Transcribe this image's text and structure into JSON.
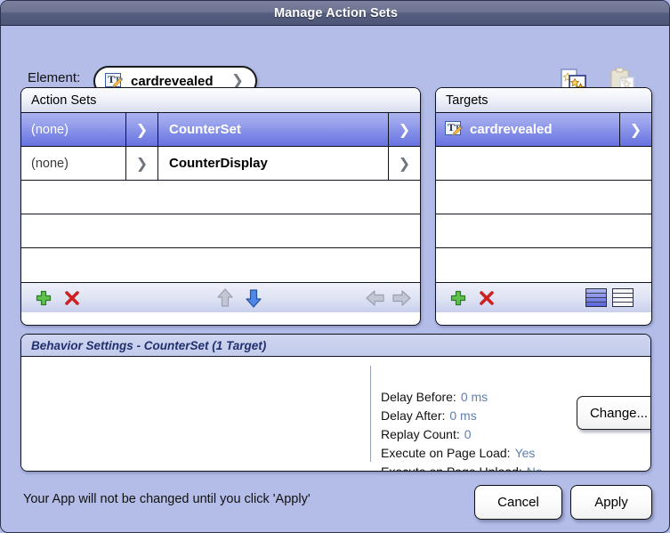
{
  "window": {
    "title": "Manage Action Sets"
  },
  "element_bar": {
    "label": "Element:",
    "icon": "text-element-icon",
    "value": "cardrevealed",
    "chevron": "❯",
    "copy_icon": "copy-action-sets-icon",
    "paste_icon": "paste-action-sets-icon"
  },
  "action_sets_panel": {
    "header": "Action Sets",
    "rows": [
      {
        "event": "(none)",
        "name": "CounterSet",
        "selected": true
      },
      {
        "event": "(none)",
        "name": "CounterDisplay",
        "selected": false
      },
      {
        "event": "",
        "name": "",
        "selected": false
      },
      {
        "event": "",
        "name": "",
        "selected": false
      },
      {
        "event": "",
        "name": "",
        "selected": false
      }
    ],
    "toolbar": {
      "add": "add-action-set",
      "delete": "delete-action-set",
      "move_up": "move-up",
      "move_down": "move-down",
      "move_left": "move-left",
      "move_right": "move-right"
    }
  },
  "targets_panel": {
    "header": "Targets",
    "rows": [
      {
        "name": "cardrevealed",
        "icon": "text-element-icon",
        "selected": true
      },
      {
        "name": "",
        "icon": "",
        "selected": false
      },
      {
        "name": "",
        "icon": "",
        "selected": false
      },
      {
        "name": "",
        "icon": "",
        "selected": false
      },
      {
        "name": "",
        "icon": "",
        "selected": false
      }
    ],
    "toolbar": {
      "add": "add-target",
      "delete": "delete-target",
      "view_detail": "detail-view-toggle",
      "view_list": "list-view-toggle"
    }
  },
  "behavior_settings": {
    "header": "Behavior Settings - CounterSet (1 Target)",
    "rows": [
      {
        "label": "Delay Before:",
        "value": "0 ms"
      },
      {
        "label": "Delay After:",
        "value": "0 ms"
      },
      {
        "label": "Replay Count:",
        "value": "0"
      },
      {
        "label": "Execute on Page Load:",
        "value": "Yes"
      },
      {
        "label": "Execute on Page Unload:",
        "value": "No"
      }
    ],
    "change_label": "Change..."
  },
  "footer": {
    "note": "Your App will not be changed until you click 'Apply'",
    "cancel_label": "Cancel",
    "apply_label": "Apply"
  },
  "colors": {
    "dialog_background": "#b3bde8",
    "titlebar": "#626a8a",
    "selection": "#7b86e6",
    "value_text": "#5f7fb0",
    "behavior_header_text": "#20306d",
    "add_icon": "#3ba539",
    "delete_icon": "#cc2222",
    "arrow_enabled": "#3c78d8",
    "arrow_disabled": "#b9bdc9"
  }
}
